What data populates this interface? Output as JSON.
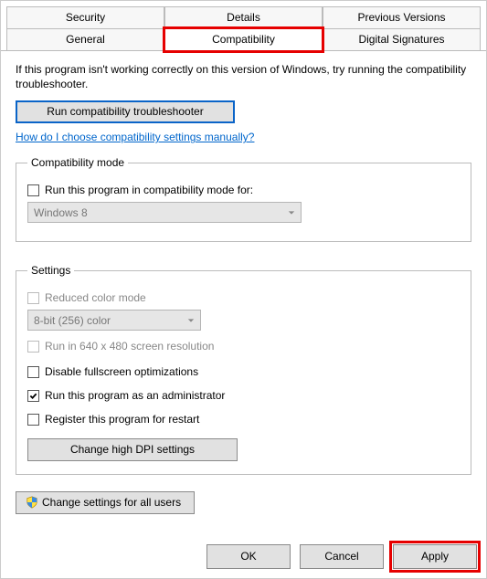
{
  "tabs": {
    "row1": {
      "security": "Security",
      "details": "Details",
      "previous": "Previous Versions"
    },
    "row2": {
      "general": "General",
      "compatibility": "Compatibility",
      "signatures": "Digital Signatures"
    }
  },
  "intro": "If this program isn't working correctly on this version of Windows, try running the compatibility troubleshooter.",
  "troubleshooter_btn": "Run compatibility troubleshooter",
  "help_link": "How do I choose compatibility settings manually?",
  "compat_mode": {
    "legend": "Compatibility mode",
    "checkbox": "Run this program in compatibility mode for:",
    "combo": "Windows 8"
  },
  "settings": {
    "legend": "Settings",
    "reduced_color": "Reduced color mode",
    "color_combo": "8-bit (256) color",
    "run_640": "Run in 640 x 480 screen resolution",
    "disable_fullscreen": "Disable fullscreen optimizations",
    "run_admin": "Run this program as an administrator",
    "register_restart": "Register this program for restart",
    "dpi_btn": "Change high DPI settings"
  },
  "all_users_btn": "Change settings for all users",
  "buttons": {
    "ok": "OK",
    "cancel": "Cancel",
    "apply": "Apply"
  }
}
